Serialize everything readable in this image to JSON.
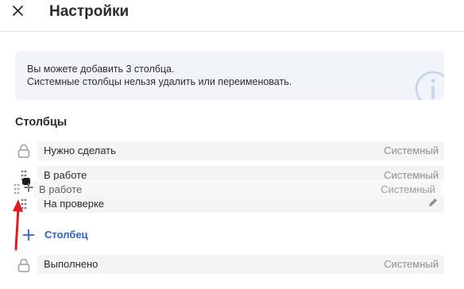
{
  "header": {
    "title": "Настройки",
    "close_icon": "close-icon"
  },
  "info": {
    "line1": "Вы можете добавить 3 столбца.",
    "line2": "Системные столбцы нельзя удалить или переименовать.",
    "icon": "info-icon"
  },
  "columns_section": {
    "title": "Столбцы",
    "columns": [
      {
        "name": "Нужно сделать",
        "tag": "Системный",
        "icon": "lock-icon"
      },
      {
        "name": "В работе",
        "tag": "Системный",
        "icon": "drag-handle-icon"
      },
      {
        "name": "На проверке",
        "tag": "",
        "icon": "drag-handle-icon",
        "action_icon": "pencil-icon"
      }
    ],
    "dragging": {
      "name": "В работе",
      "tag": "Системный"
    },
    "add_label": "Столбец",
    "done_column": {
      "name": "Выполнено",
      "tag": "Системный",
      "icon": "lock-icon"
    }
  },
  "colors": {
    "accent": "#2b63c4",
    "info_bg": "#f1f5fa",
    "row_bg": "#f3f4f6",
    "system_tag": "#8d8f93",
    "annotation_arrow": "#e31b23"
  }
}
